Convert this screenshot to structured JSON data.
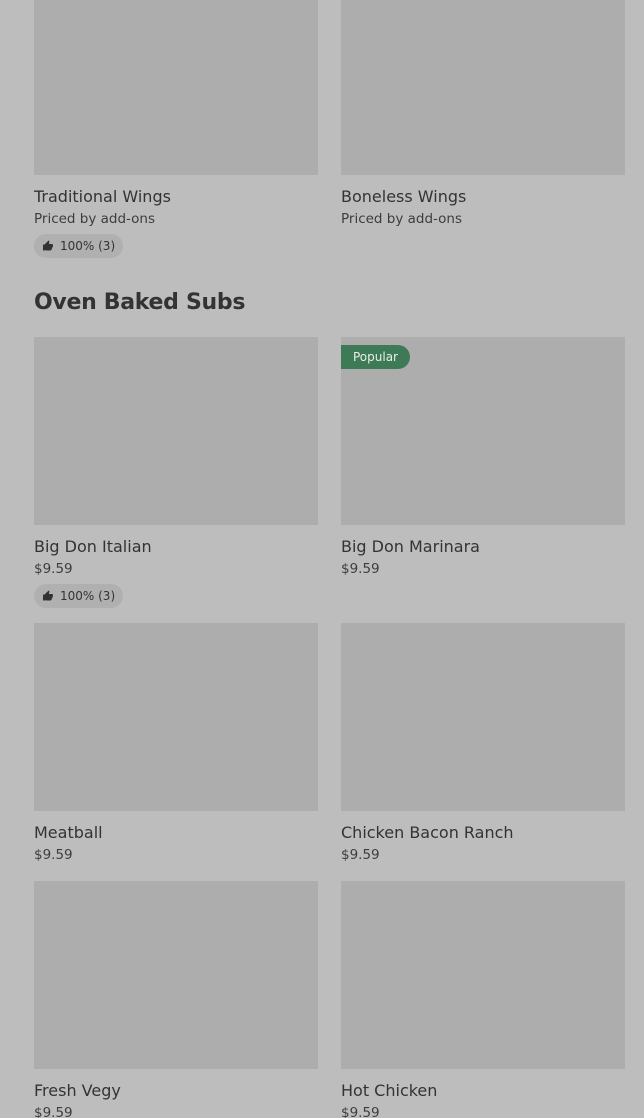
{
  "top_items": [
    {
      "name": "Traditional Wings",
      "price": "Priced by add-ons",
      "rating": "100% (3)"
    },
    {
      "name": "Boneless Wings",
      "price": "Priced by add-ons"
    }
  ],
  "section": {
    "title": "Oven Baked Subs",
    "badge_label": "Popular",
    "items": [
      {
        "name": "Big Don Italian",
        "price": "$9.59",
        "rating": "100% (3)"
      },
      {
        "name": "Big Don Marinara",
        "price": "$9.59"
      },
      {
        "name": "Meatball",
        "price": "$9.59"
      },
      {
        "name": "Chicken Bacon Ranch",
        "price": "$9.59"
      },
      {
        "name": "Fresh Vegy",
        "price": "$9.59"
      },
      {
        "name": "Hot Chicken",
        "price": "$9.59"
      }
    ]
  },
  "icons": {
    "rating_icon": "thumbs-up-icon"
  },
  "colors": {
    "background": "#bdbdbd",
    "image_placeholder": "#adadad",
    "badge_green": "#3f7a56",
    "text": "#333333"
  }
}
